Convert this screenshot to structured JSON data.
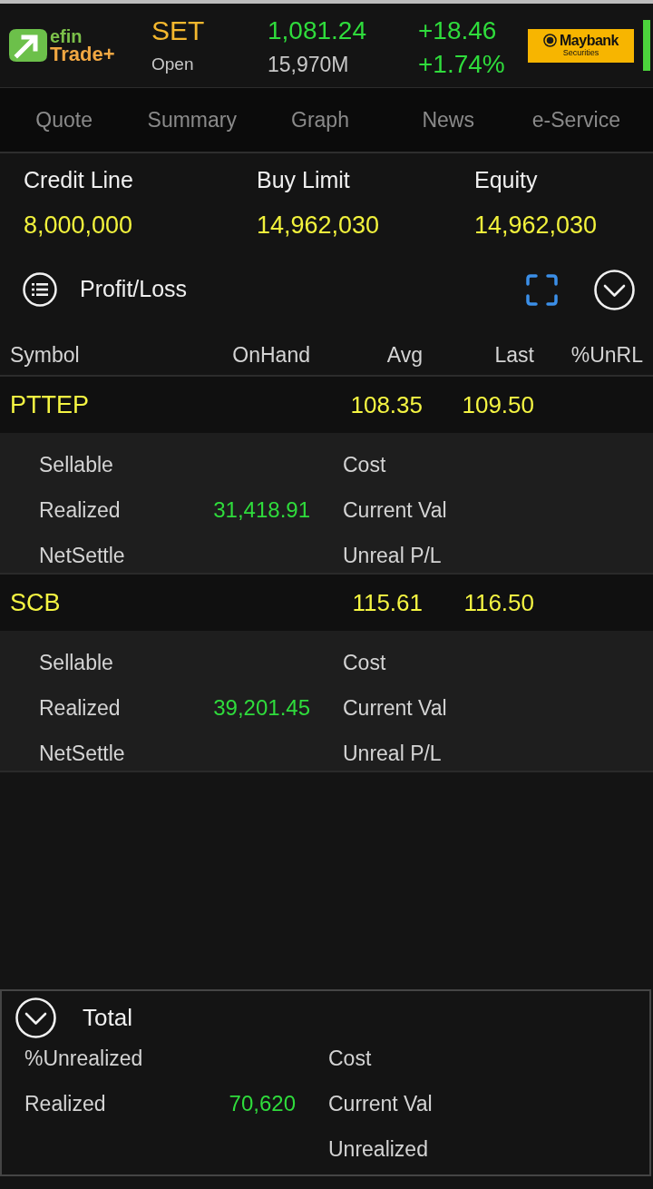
{
  "header": {
    "app_logo": {
      "top": "efin",
      "bottom": "Trade+"
    },
    "market": "SET",
    "market_state": "Open",
    "index_value": "1,081.24",
    "volume": "15,970M",
    "change": "+18.46",
    "change_percent": "+1.74%",
    "broker_logo": {
      "name": "Maybank",
      "subtitle": "Securities"
    }
  },
  "tabs": [
    {
      "label": "Quote",
      "selected": false
    },
    {
      "label": "Summary",
      "selected": false
    },
    {
      "label": "Graph",
      "selected": false
    },
    {
      "label": "News",
      "selected": false
    },
    {
      "label": "e-Service",
      "selected": false
    }
  ],
  "account": [
    {
      "label": "Credit Line",
      "value": "8,000,000"
    },
    {
      "label": "Buy Limit",
      "value": "14,962,030"
    },
    {
      "label": "Equity",
      "value": "14,962,030"
    }
  ],
  "portfolio": {
    "title": "Profit/Loss",
    "columns": [
      "Symbol",
      "OnHand",
      "Avg",
      "Last",
      "%UnRL"
    ],
    "rows": [
      {
        "symbol": "PTTEP",
        "avg": "108.35",
        "last": "109.50",
        "details": [
          {
            "label": "Sellable",
            "right_label": "Cost"
          },
          {
            "label": "Realized",
            "value": "31,418.91",
            "right_label": "Current Val"
          },
          {
            "label": "NetSettle",
            "right_label": "Unreal P/L"
          }
        ]
      },
      {
        "symbol": "SCB",
        "avg": "115.61",
        "last": "116.50",
        "details": [
          {
            "label": "Sellable",
            "right_label": "Cost"
          },
          {
            "label": "Realized",
            "value": "39,201.45",
            "right_label": "Current Val"
          },
          {
            "label": "NetSettle",
            "right_label": "Unreal P/L"
          }
        ]
      }
    ]
  },
  "total": {
    "title": "Total",
    "details": [
      {
        "label": "%Unrealized",
        "right_label": "Cost"
      },
      {
        "label": "Realized",
        "value": "70,620",
        "right_label": "Current Val"
      },
      {
        "right_label": "Unrealized"
      }
    ]
  }
}
